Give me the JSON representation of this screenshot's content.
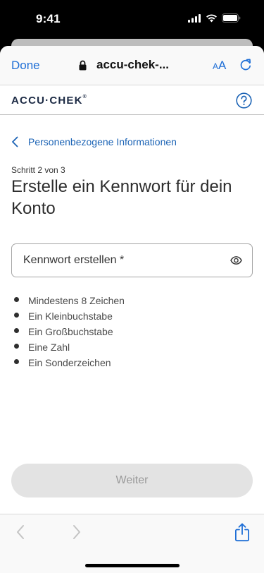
{
  "status_bar": {
    "time": "9:41"
  },
  "browser": {
    "done_label": "Done",
    "url": "accu-chek-...",
    "text_size_small": "A",
    "text_size_large": "A"
  },
  "site": {
    "logo_text": "ACCU·CHEK",
    "logo_mark": "®"
  },
  "form": {
    "back_label": "Personenbezogene Informationen",
    "step": "Schritt 2 von 3",
    "title": "Erstelle ein Kennwort für dein Konto",
    "password_placeholder": "Kennwort erstellen *",
    "requirements": [
      "Mindestens 8 Zeichen",
      "Ein Kleinbuchstabe",
      "Ein Großbuchstabe",
      "Eine Zahl",
      "Ein Sonderzeichen"
    ],
    "submit_label": "Weiter"
  },
  "colors": {
    "accent": "#1f6fd6",
    "link": "#1b63b5",
    "disabled_button": "#e3e3e3",
    "disabled_text": "#9a9a9a"
  }
}
